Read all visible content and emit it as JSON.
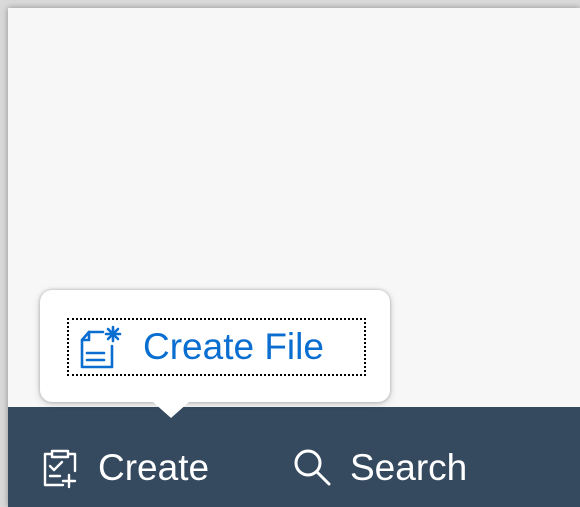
{
  "popover": {
    "items": [
      {
        "label": "Create File",
        "icon": "create-file-icon"
      }
    ]
  },
  "footer": {
    "create": {
      "label": "Create",
      "icon": "create-clipboard-icon"
    },
    "search": {
      "label": "Search",
      "icon": "search-icon"
    }
  },
  "colors": {
    "footer_bg": "#354a5f",
    "accent": "#0a6ed1",
    "content_bg": "#f7f7f7"
  }
}
